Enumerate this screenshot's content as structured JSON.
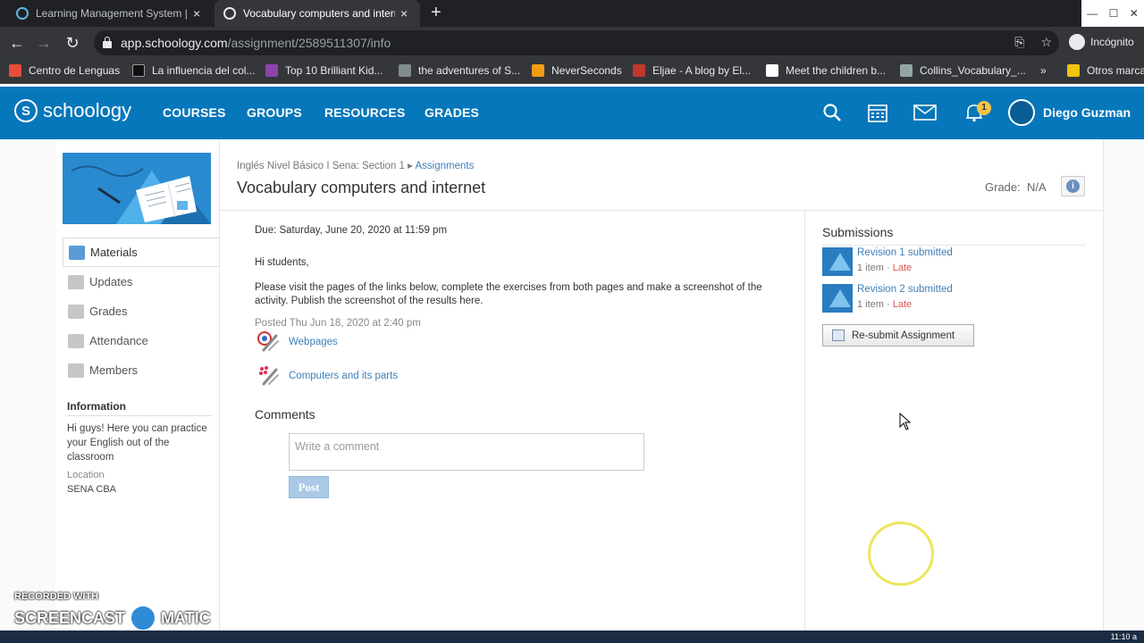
{
  "browser": {
    "tabs": [
      {
        "title": "Learning Management System | I",
        "close": "×"
      },
      {
        "title": "Vocabulary computers and interr",
        "close": "×"
      }
    ],
    "new_tab": "+",
    "url_host": "app.schoology.com",
    "url_path": "/assignment/2589511307/info",
    "incognito": "Incógnito",
    "bookmarks": [
      {
        "label": "Centro de Lenguas",
        "color": "#e74c3c"
      },
      {
        "label": "La influencia del col...",
        "color": "#111111"
      },
      {
        "label": "Top 10 Brilliant Kid...",
        "color": "#8e44ad"
      },
      {
        "label": "the adventures of S...",
        "color": "#7f8c8d"
      },
      {
        "label": "NeverSeconds",
        "color": "#f39c12"
      },
      {
        "label": "Eljae - A blog by El...",
        "color": "#c0392b"
      },
      {
        "label": "Meet the children b...",
        "color": "#ffffff"
      },
      {
        "label": "Collins_Vocabulary_...",
        "color": "#95a5a6"
      },
      {
        "label": "»",
        "color": ""
      },
      {
        "label": "Otros marca",
        "color": "#f1c40f"
      }
    ]
  },
  "header": {
    "logo": "schoology",
    "nav": [
      "COURSES",
      "GROUPS",
      "RESOURCES",
      "GRADES"
    ],
    "notification_count": "1",
    "user_name": "Diego Guzman",
    "colors": {
      "brand": "#0677ba"
    }
  },
  "sidebar": {
    "items": [
      {
        "label": "Materials",
        "icon": "materials-icon"
      },
      {
        "label": "Updates",
        "icon": "updates-icon"
      },
      {
        "label": "Grades",
        "icon": "grades-icon"
      },
      {
        "label": "Attendance",
        "icon": "attendance-icon"
      },
      {
        "label": "Members",
        "icon": "members-icon"
      }
    ],
    "info_heading": "Information",
    "info_text": "Hi guys! Here you can practice your English out of the classroom",
    "location_label": "Location",
    "location_value": "SENA CBA"
  },
  "assignment": {
    "breadcrumb_course": "Inglés Nivel Básico I Sena: Section 1",
    "breadcrumb_sep": "▸",
    "breadcrumb_section": "Assignments",
    "title": "Vocabulary computers and internet",
    "grade_label": "Grade:",
    "grade_value": "N/A",
    "due": "Due: Saturday, June 20, 2020 at 11:59 pm",
    "greeting": "Hi students,",
    "body": "Please visit the pages of the links below, complete the exercises from both pages and make a screenshot of the activity. Publish the screenshot of the results here.",
    "posted": "Posted Thu Jun 18, 2020 at 2:40 pm",
    "links": [
      "Webpages",
      "Computers and its parts"
    ],
    "comments_heading": "Comments",
    "comment_placeholder": "Write a comment",
    "post_label": "Post"
  },
  "submissions": {
    "heading": "Submissions",
    "revisions": [
      {
        "title": "Revision 1 submitted",
        "items": "1 item",
        "sep": "·",
        "status": "Late"
      },
      {
        "title": "Revision 2 submitted",
        "items": "1 item",
        "sep": "·",
        "status": "Late"
      }
    ],
    "resubmit_label": "Re-submit Assignment"
  },
  "watermark": {
    "line1": "RECORDED WITH",
    "line2a": "SCREENCAST",
    "line2b": "MATIC"
  },
  "clock": "11:10 a"
}
